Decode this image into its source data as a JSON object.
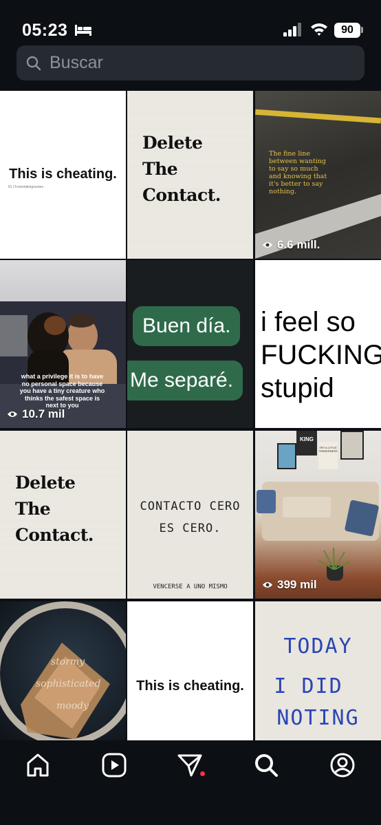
{
  "status_bar": {
    "time": "05:23",
    "battery": "90"
  },
  "search": {
    "placeholder": "Buscar"
  },
  "tiles": [
    {
      "text": "This is cheating.",
      "credit": "IG | Fcwrelatioignuotes"
    },
    {
      "text_lines": [
        "Delete",
        "The",
        "Contact."
      ]
    },
    {
      "quote": "The fine line between wanting to say so much and knowing that it's better to say nothing.",
      "views": "6.6 mill."
    },
    {
      "caption": "what a privilege it is to have no personal space because you have a tiny creature who thinks the safest space is next to you",
      "views": "10.7 mil"
    },
    {
      "bubbles": [
        "Buen día.",
        "Me separé."
      ]
    },
    {
      "text_lines": [
        "i feel so",
        "FUCKING",
        "stupid"
      ]
    },
    {
      "text_lines": [
        "Delete",
        "The",
        "Contact."
      ]
    },
    {
      "text_lines": [
        "CONTACTO CERO",
        "ES CERO."
      ],
      "footer": "VENCERSE A UNO MISMO"
    },
    {
      "poster_labels": [
        "KING",
        "TRY A LITTLE TENDERNESS"
      ],
      "views": "399 mil"
    },
    {
      "text_lines": [
        "stormy",
        "sophisticated",
        "moody"
      ]
    },
    {
      "text": "This is cheating."
    },
    {
      "text_lines": [
        "TODAY",
        "I DID",
        "NOTING"
      ]
    }
  ],
  "nav": {
    "items": [
      "home-icon",
      "reels-icon",
      "messages-icon",
      "search-icon",
      "profile-icon"
    ],
    "active": "search-icon"
  },
  "colors": {
    "background": "#0c0f14",
    "search_bg": "#262a31",
    "chat_bubble": "#2f6b4b",
    "notification_dot": "#ff3040",
    "handwriting_blue": "#2845b5"
  }
}
